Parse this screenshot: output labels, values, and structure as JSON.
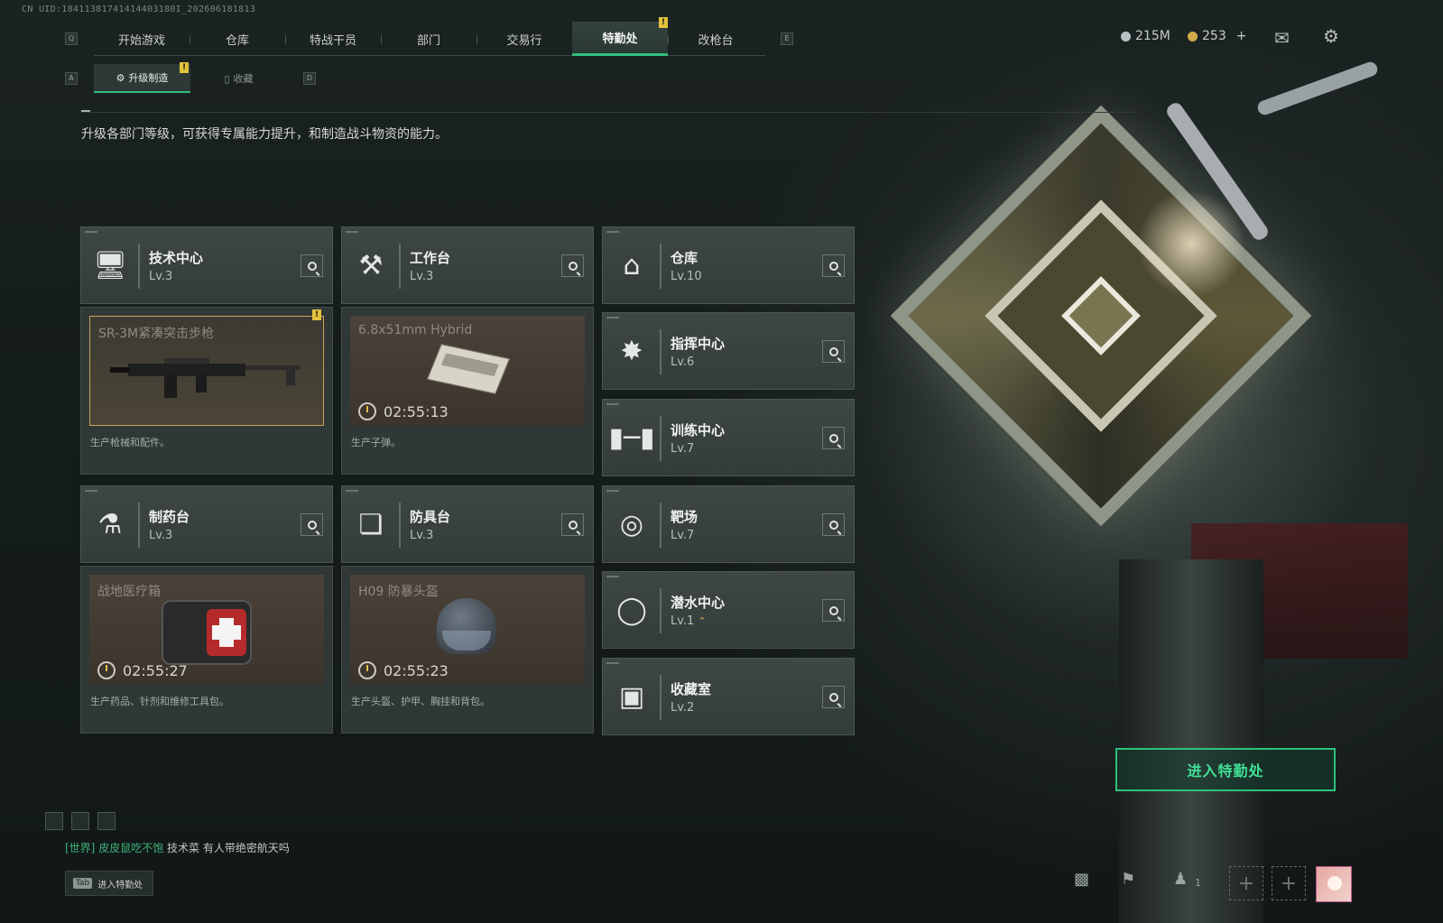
{
  "uid": "CN UID:18411381741414403180I_202606181813",
  "nav": {
    "left_key": "Q",
    "right_key": "E",
    "tabs": [
      "开始游戏",
      "仓库",
      "特战干员",
      "部门",
      "交易行",
      "特勤处",
      "改枪台"
    ],
    "active_index": 5,
    "active_badge": "!"
  },
  "currency": {
    "silver": "215M",
    "gold": "253",
    "gold_add": "+",
    "silver_color": "#b9c3c5",
    "gold_color": "#d2a94a"
  },
  "subnav": {
    "left_key": "A",
    "right_key": "D",
    "tabs": [
      "升级制造",
      "收藏"
    ],
    "active_index": 0,
    "badge": "!"
  },
  "description": "升级各部门等级，可获得专属能力提升，和制造战斗物资的能力。",
  "departments": [
    {
      "name": "技术中心",
      "level": "Lv.3",
      "icon": "computer-icon"
    },
    {
      "name": "工作台",
      "level": "Lv.3",
      "icon": "tools-icon"
    },
    {
      "name": "仓库",
      "level": "Lv.10",
      "icon": "warehouse-icon"
    },
    {
      "name": "指挥中心",
      "level": "Lv.6",
      "icon": "command-icon"
    },
    {
      "name": "训练中心",
      "level": "Lv.7",
      "icon": "dumbbell-icon"
    },
    {
      "name": "制药台",
      "level": "Lv.3",
      "icon": "microscope-icon"
    },
    {
      "name": "防具台",
      "level": "Lv.3",
      "icon": "armor-cubes-icon"
    },
    {
      "name": "靶场",
      "level": "Lv.7",
      "icon": "target-icon"
    },
    {
      "name": "潜水中心",
      "level": "Lv.1",
      "icon": "diving-mask-icon"
    },
    {
      "name": "收藏室",
      "level": "Lv.2",
      "icon": "collection-icon"
    }
  ],
  "production": [
    {
      "item": "SR-3M紧凑突击步枪",
      "timer": "",
      "desc": "生产枪械和配件。",
      "ready": true,
      "badge": "!"
    },
    {
      "item": "6.8x51mm Hybrid",
      "timer": "02:55:13",
      "desc": "生产子弹。",
      "ready": false
    },
    {
      "item": "战地医疗箱",
      "timer": "02:55:27",
      "desc": "生产药品、针剂和维修工具包。",
      "ready": false
    },
    {
      "item": "H09 防暴头盔",
      "timer": "02:55:23",
      "desc": "生产头盔、护甲、胸挂和背包。",
      "ready": false
    }
  ],
  "chat": {
    "channel": "[世界]",
    "sender": "皮皮鼠吃不饱",
    "message": "技术菜 有人带绝密航天吗"
  },
  "tab_hint": {
    "key": "Tab",
    "label": "进入特勤处"
  },
  "enter_button": "进入特勤处",
  "bottom": {
    "friends_count": "1",
    "add_symbol": "+"
  },
  "colors": {
    "accent_green": "#30c07f",
    "badge_yellow": "#e3c33c"
  }
}
